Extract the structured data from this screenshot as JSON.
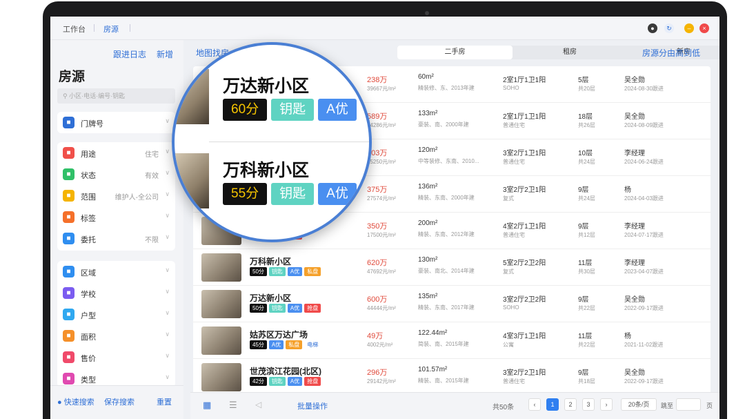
{
  "titlebar": {
    "tabs": [
      "工作台",
      "房源"
    ]
  },
  "sidebar": {
    "links": [
      "跟进日志",
      "新增"
    ],
    "title": "房源",
    "search_placeholder": "小区·电话·编号·钥匙",
    "card1": [
      {
        "label": "门牌号",
        "value": "",
        "color": "#2f6fd6",
        "icon": "house-icon"
      }
    ],
    "card2": [
      {
        "label": "用途",
        "value": "住宅",
        "color": "#f0504a",
        "icon": "pen-icon"
      },
      {
        "label": "状态",
        "value": "有效",
        "color": "#30c068",
        "icon": "trend-icon"
      },
      {
        "label": "范围",
        "value": "维护人-全公司",
        "color": "#f5b400",
        "icon": "target-icon"
      },
      {
        "label": "标签",
        "value": "",
        "color": "#f5702a",
        "icon": "tag-icon"
      },
      {
        "label": "委托",
        "value": "不限",
        "color": "#2f8ef0",
        "icon": "handshake-icon"
      }
    ],
    "card3": [
      {
        "label": "区域",
        "value": "",
        "color": "#2f8ef0",
        "icon": "send-icon"
      },
      {
        "label": "学校",
        "value": "",
        "color": "#7b5cf0",
        "icon": "school-icon"
      },
      {
        "label": "户型",
        "value": "",
        "color": "#2fa8f0",
        "icon": "layout-icon"
      },
      {
        "label": "面积",
        "value": "",
        "color": "#f5902a",
        "icon": "area-icon"
      },
      {
        "label": "售价",
        "value": "",
        "color": "#f04a6a",
        "icon": "price-icon"
      },
      {
        "label": "类型",
        "value": "",
        "color": "#e04ab0",
        "icon": "type-icon"
      }
    ],
    "footer": {
      "quick": "快速搜索",
      "save": "保存搜索",
      "reset": "重置"
    }
  },
  "main": {
    "map_link": "地图找房",
    "segments": [
      "二手房",
      "租房",
      "新房"
    ],
    "sort": "房源分由高到低",
    "listings": [
      {
        "name": "万达新小区",
        "tags": [
          [
            "60分",
            "#111"
          ],
          [
            "钥匙",
            "#5fd3c2"
          ],
          [
            "A优",
            "#4a8ff0"
          ]
        ],
        "price": "238万",
        "unit": "39667元/m²",
        "area": "60m²",
        "detail": "精装修、东、2013年建",
        "layout": "2室1厅1卫1阳",
        "type": "SOHO",
        "floor": "5层",
        "total": "共20层",
        "agent": "吴全勋",
        "follow": "2024-08-30跟进"
      },
      {
        "name": "",
        "tags": [],
        "price": "589万",
        "unit": "44286元/m²",
        "area": "133m²",
        "detail": "豪装、南、2000年建",
        "layout": "2室1厅1卫1阳",
        "type": "普通住宅",
        "floor": "18层",
        "total": "共26层",
        "agent": "吴全勋",
        "follow": "2024-08-09跟进"
      },
      {
        "name": "万科新小区",
        "tags": [
          [
            "55分",
            "#111"
          ],
          [
            "钥匙",
            "#5fd3c2"
          ],
          [
            "A优",
            "#4a8ff0"
          ]
        ],
        "price": "303万",
        "unit": "25250元/m²",
        "area": "120m²",
        "detail": "中等装修、东南、2010...",
        "layout": "3室2厅1卫1阳",
        "type": "普通住宅",
        "floor": "10层",
        "total": "共24层",
        "agent": "李经理",
        "follow": "2024-06-24跟进"
      },
      {
        "name": "",
        "tags": [],
        "price": "375万",
        "unit": "27574元/m²",
        "area": "136m²",
        "detail": "精装、东南、2000年建",
        "layout": "3室2厅2卫1阳",
        "type": "复式",
        "floor": "9层",
        "total": "共24层",
        "agent": "杨",
        "follow": "2024-04-03跟进"
      },
      {
        "name": "",
        "tags": [
          [
            "51分",
            "#111"
          ],
          [
            "A优",
            "#4a8ff0"
          ],
          [
            "抢盘",
            "#f04a4a"
          ]
        ],
        "price": "350万",
        "unit": "17500元/m²",
        "area": "200m²",
        "detail": "精装、东南、2012年建",
        "layout": "4室2厅1卫1阳",
        "type": "普通住宅",
        "floor": "9层",
        "total": "共12层",
        "agent": "李经理",
        "follow": "2024-07-17跟进"
      },
      {
        "name": "万科新小区",
        "tags": [
          [
            "50分",
            "#111"
          ],
          [
            "钥匙",
            "#5fd3c2"
          ],
          [
            "A优",
            "#4a8ff0"
          ],
          [
            "私盘",
            "#f5a02a"
          ]
        ],
        "price": "620万",
        "unit": "47692元/m²",
        "area": "130m²",
        "detail": "豪装、南北、2014年建",
        "layout": "5室2厅2卫2阳",
        "type": "复式",
        "floor": "11层",
        "total": "共30层",
        "agent": "李经理",
        "follow": "2023-04-07跟进"
      },
      {
        "name": "万达新小区",
        "tags": [
          [
            "50分",
            "#111"
          ],
          [
            "钥匙",
            "#5fd3c2"
          ],
          [
            "A优",
            "#4a8ff0"
          ],
          [
            "抢盘",
            "#f04a4a"
          ]
        ],
        "price": "600万",
        "unit": "44444元/m²",
        "area": "135m²",
        "detail": "精装、东南、2017年建",
        "layout": "3室2厅2卫2阳",
        "type": "SOHO",
        "floor": "9层",
        "total": "共22层",
        "agent": "吴全勋",
        "follow": "2022-09-17跟进"
      },
      {
        "name": "姑苏区万达广场",
        "tags": [
          [
            "45分",
            "#111"
          ],
          [
            "A优",
            "#4a8ff0"
          ],
          [
            "私盘",
            "#f5a02a"
          ],
          [
            "电梯",
            "#ffffff"
          ]
        ],
        "price": "49万",
        "unit": "4002元/m²",
        "area": "122.44m²",
        "detail": "简装、南、2015年建",
        "layout": "4室3厅1卫1阳",
        "type": "公寓",
        "floor": "11层",
        "total": "共22层",
        "agent": "杨",
        "follow": "2021-11-02跟进"
      },
      {
        "name": "世茂滨江花园(北区)",
        "tags": [
          [
            "42分",
            "#111"
          ],
          [
            "钥匙",
            "#5fd3c2"
          ],
          [
            "A优",
            "#4a8ff0"
          ],
          [
            "抢盘",
            "#f04a4a"
          ]
        ],
        "price": "296万",
        "unit": "29142元/m²",
        "area": "101.57m²",
        "detail": "精装、南、2015年建",
        "layout": "3室2厅2卫1阳",
        "type": "普通住宅",
        "floor": "9层",
        "total": "共18层",
        "agent": "吴全勋",
        "follow": "2022-09-17跟进"
      }
    ],
    "bottom": {
      "batch": "批量操作",
      "total": "共50条",
      "pages": [
        "1",
        "2",
        "3"
      ],
      "per_page": "20条/页",
      "jump": "跳至",
      "page_unit": "页"
    }
  },
  "magnifier": {
    "items": [
      {
        "name": "万达新小区",
        "tags": [
          [
            "60分",
            "#111"
          ],
          [
            "钥匙",
            "#5fd3c2"
          ],
          [
            "A优",
            "#4a8ff0"
          ]
        ]
      },
      {
        "name": "万科新小区",
        "tags": [
          [
            "55分",
            "#111"
          ],
          [
            "钥匙",
            "#5fd3c2"
          ],
          [
            "A优",
            "#4a8ff0"
          ]
        ]
      }
    ]
  }
}
